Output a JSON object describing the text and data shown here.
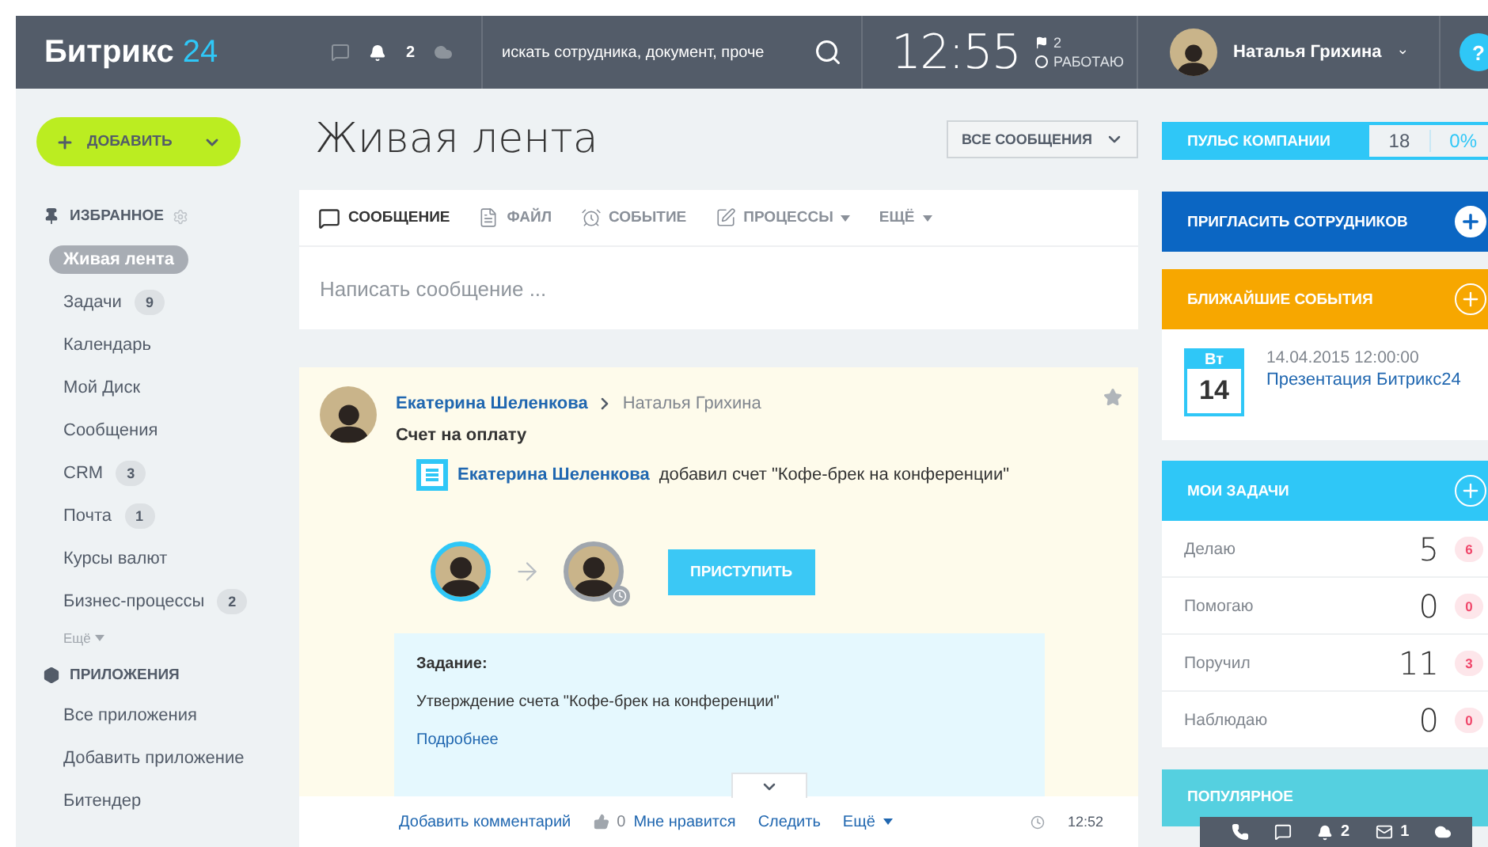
{
  "header": {
    "logo": "Битрикс",
    "logo_accent": "24",
    "notifications": "2",
    "search": {
      "placeholder": "искать сотрудника, документ, проче"
    },
    "time": "12:55",
    "flags": "2",
    "status": "РАБОТАЮ",
    "user": "Наталья Грихина",
    "help": "?"
  },
  "sidebar": {
    "add_button": "ДОБАВИТЬ",
    "favorites_title": "ИЗБРАННОЕ",
    "items": [
      {
        "label": "Живая лента",
        "selected": true
      },
      {
        "label": "Задачи",
        "count": "9",
        "selected": false
      },
      {
        "label": "Календарь",
        "selected": false
      },
      {
        "label": "Мой Диск",
        "selected": false
      },
      {
        "label": "Сообщения",
        "selected": false
      },
      {
        "label": "CRM",
        "count": "3",
        "selected": false
      },
      {
        "label": "Почта",
        "count": "1",
        "selected": false
      },
      {
        "label": "Курсы валют",
        "selected": false
      },
      {
        "label": "Бизнес-процессы",
        "count": "2",
        "selected": false
      }
    ],
    "more": "Ещё",
    "apps_title": "ПРИЛОЖЕНИЯ",
    "apps": [
      "Все приложения",
      "Добавить приложение",
      "Битендер"
    ]
  },
  "main": {
    "title": "Живая лента",
    "filter": "ВСЕ СООБЩЕНИЯ",
    "composer_tabs": [
      {
        "label": "СООБЩЕНИЕ",
        "kind": "message",
        "selected": true
      },
      {
        "label": "ФАЙЛ",
        "kind": "file",
        "selected": false
      },
      {
        "label": "СОБЫТИЕ",
        "kind": "event",
        "selected": false
      },
      {
        "label": "ПРОЦЕССЫ",
        "kind": "process",
        "selected": false
      },
      {
        "label": "ЕЩЁ",
        "kind": "more",
        "selected": false
      }
    ],
    "composer_placeholder": "Написать сообщение ...",
    "post": {
      "author": "Екатерина Шеленкова",
      "recipient": "Наталья Грихина",
      "title": "Счет на оплату",
      "activity_author": "Екатерина Шеленкова",
      "activity_text": "добавил счет \"Кофе-брек на конференции\"",
      "action_button": "ПРИСТУПИТЬ",
      "task_label": "Задание:",
      "task_text": "Утверждение счета \"Кофе-брек на конференции\"",
      "task_link": "Подробнее",
      "footer": {
        "comment": "Добавить комментарий",
        "likes": "0",
        "like": "Мне нравится",
        "follow": "Следить",
        "more": "Ещё",
        "time": "12:52"
      }
    }
  },
  "right": {
    "pulse": {
      "label": "ПУЛЬС КОМПАНИИ",
      "count": "18",
      "percent": "0%"
    },
    "invite": "ПРИГЛАСИТЬ СОТРУДНИКОВ",
    "events": {
      "title": "БЛИЖАЙШИЕ СОБЫТИЯ",
      "weekday": "Вт",
      "day": "14",
      "datetime": "14.04.2015 12:00:00",
      "link": "Презентация Битрикс24"
    },
    "tasks": {
      "title": "МОИ ЗАДАЧИ",
      "rows": [
        {
          "label": "Делаю",
          "count": "5",
          "badge": "6"
        },
        {
          "label": "Помогаю",
          "count": "0",
          "badge": "0"
        },
        {
          "label": "Поручил",
          "count": "11",
          "badge": "3"
        },
        {
          "label": "Наблюдаю",
          "count": "0",
          "badge": "0"
        }
      ]
    },
    "popular": "ПОПУЛЯРНОЕ"
  },
  "dock": {
    "notifications": "2",
    "mail": "1"
  }
}
